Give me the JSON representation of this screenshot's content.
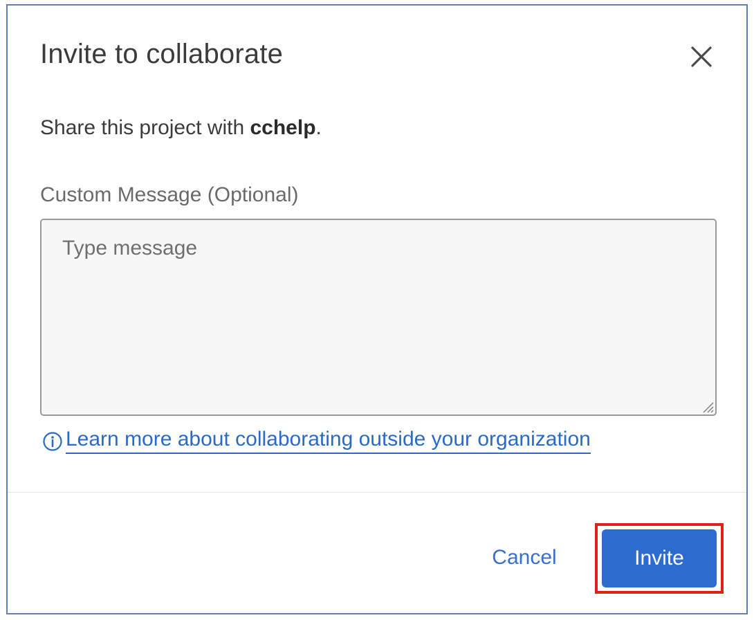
{
  "dialog": {
    "title": "Invite to collaborate",
    "close_icon": "close-icon"
  },
  "share": {
    "prefix": "Share this project with ",
    "project_name": "cchelp",
    "suffix": "."
  },
  "message": {
    "label": "Custom Message (Optional)",
    "placeholder": "Type message",
    "value": ""
  },
  "learn_more": {
    "icon": "info-icon",
    "text": "Learn more about collaborating outside your organization"
  },
  "footer": {
    "cancel_label": "Cancel",
    "invite_label": "Invite",
    "invite_highlighted": true
  },
  "colors": {
    "accent": "#2d6bcf",
    "link": "#2a6ac8",
    "highlight": "#e0211a",
    "frame": "#5b7fbf"
  }
}
